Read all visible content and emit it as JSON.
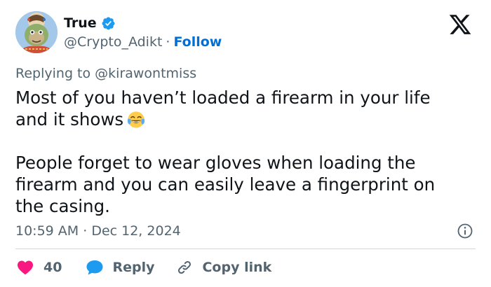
{
  "author": {
    "display_name": "True",
    "handle": "@Crypto_Adikt",
    "separator": "·",
    "follow_label": "Follow",
    "avatar_icon": "cartoon-ape-avatar",
    "verified_icon": "verified-badge-icon"
  },
  "platform": {
    "logo_icon": "x-logo-icon"
  },
  "tweet": {
    "replying_prefix": "Replying to ",
    "replying_to": "@kirawontmiss",
    "line1": "Most of you haven’t loaded a firearm in your life and it shows",
    "emoji": "face-with-tears-of-joy",
    "line2": "People forget to wear gloves when loading the firearm and you can easily leave a fingerprint on the casing.",
    "time": "10:59 AM",
    "meta_separator": "·",
    "date": "Dec 12, 2024"
  },
  "actions": {
    "like_count": "40",
    "reply_label": "Reply",
    "copy_link_label": "Copy link"
  },
  "colors": {
    "text": "#0f1419",
    "muted": "#536471",
    "link": "#006fd6",
    "verified": "#1d9bf0",
    "like": "#f91880",
    "divider": "#cfd9de"
  }
}
